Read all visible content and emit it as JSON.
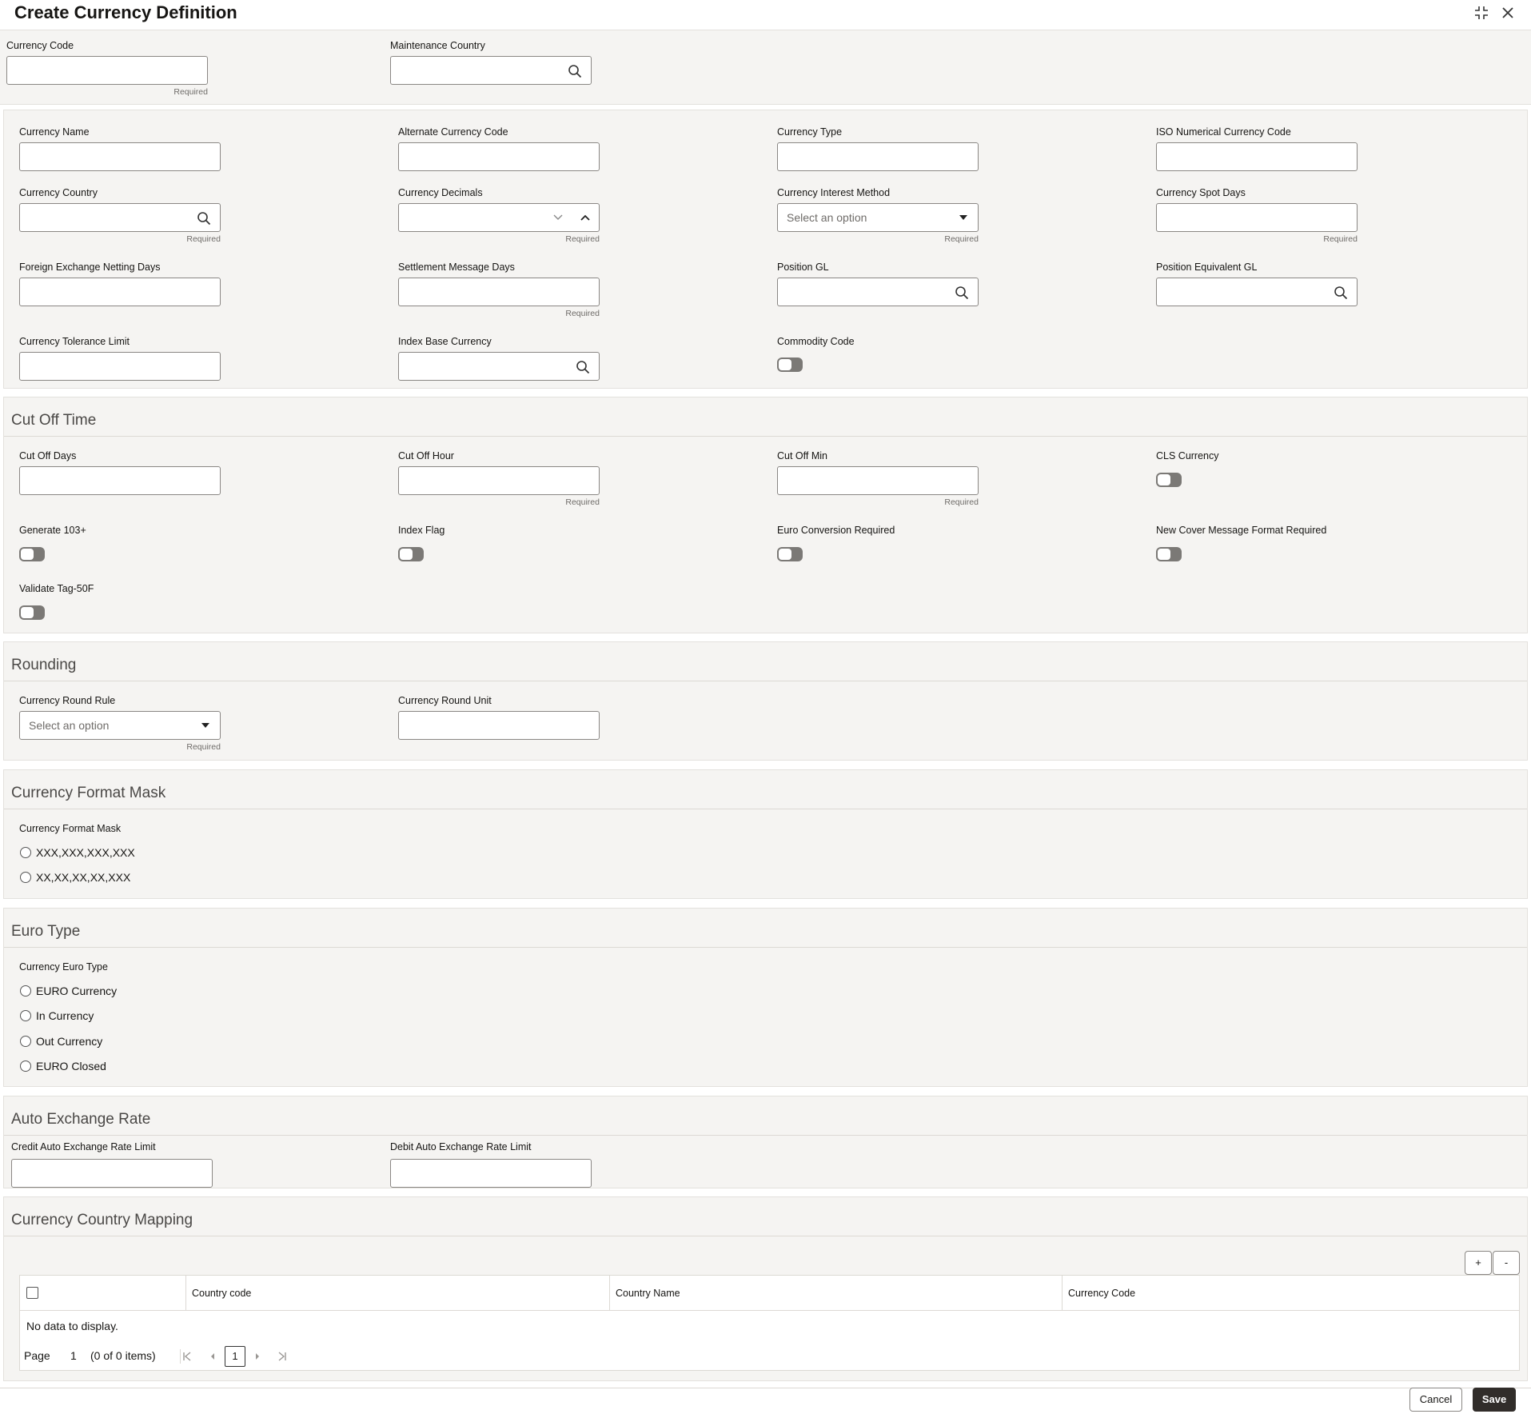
{
  "header": {
    "title": "Create Currency Definition"
  },
  "top": {
    "currency_code": {
      "label": "Currency Code",
      "value": "",
      "hint": "Required"
    },
    "maintenance_country": {
      "label": "Maintenance Country",
      "value": ""
    }
  },
  "main": {
    "currency_name": {
      "label": "Currency Name",
      "value": ""
    },
    "alternate_currency_code": {
      "label": "Alternate Currency Code",
      "value": ""
    },
    "currency_type": {
      "label": "Currency Type",
      "value": ""
    },
    "iso_numerical_code": {
      "label": "ISO Numerical Currency Code",
      "value": ""
    },
    "currency_country": {
      "label": "Currency Country",
      "value": "",
      "hint": "Required"
    },
    "currency_decimals": {
      "label": "Currency Decimals",
      "value": "",
      "hint": "Required"
    },
    "currency_interest_method": {
      "label": "Currency Interest Method",
      "placeholder": "Select an option",
      "hint": "Required"
    },
    "currency_spot_days": {
      "label": "Currency Spot Days",
      "value": "",
      "hint": "Required"
    },
    "fx_netting_days": {
      "label": "Foreign Exchange Netting Days",
      "value": ""
    },
    "settlement_message_days": {
      "label": "Settlement Message Days",
      "value": "",
      "hint": "Required"
    },
    "position_gl": {
      "label": "Position GL",
      "value": ""
    },
    "position_equivalent_gl": {
      "label": "Position Equivalent GL",
      "value": ""
    },
    "currency_tolerance_limit": {
      "label": "Currency Tolerance Limit",
      "value": ""
    },
    "index_base_currency": {
      "label": "Index Base Currency",
      "value": ""
    },
    "commodity_code": {
      "label": "Commodity Code",
      "on": false
    }
  },
  "cutoff": {
    "title": "Cut Off Time",
    "cut_off_days": {
      "label": "Cut Off Days",
      "value": ""
    },
    "cut_off_hour": {
      "label": "Cut Off Hour",
      "value": "",
      "hint": "Required"
    },
    "cut_off_min": {
      "label": "Cut Off Min",
      "value": "",
      "hint": "Required"
    },
    "cls_currency": {
      "label": "CLS Currency",
      "on": false
    },
    "generate_103": {
      "label": "Generate 103+",
      "on": false
    },
    "index_flag": {
      "label": "Index Flag",
      "on": false
    },
    "euro_conversion": {
      "label": "Euro Conversion Required",
      "on": false
    },
    "new_cover_message": {
      "label": "New Cover Message Format Required",
      "on": false
    },
    "validate_tag": {
      "label": "Validate Tag-50F",
      "on": false
    }
  },
  "rounding": {
    "title": "Rounding",
    "round_rule": {
      "label": "Currency Round Rule",
      "placeholder": "Select an option",
      "hint": "Required"
    },
    "round_unit": {
      "label": "Currency Round Unit",
      "value": ""
    }
  },
  "format_mask": {
    "title": "Currency Format Mask",
    "label": "Currency Format Mask",
    "options": [
      "XXX,XXX,XXX,XXX",
      "XX,XX,XX,XX,XXX"
    ]
  },
  "euro_type": {
    "title": "Euro Type",
    "label": "Currency Euro Type",
    "options": [
      "EURO Currency",
      "In Currency",
      "Out Currency",
      "EURO Closed"
    ]
  },
  "auto_exchange": {
    "title": "Auto Exchange Rate",
    "credit_limit": {
      "label": "Credit Auto Exchange Rate Limit",
      "value": ""
    },
    "debit_limit": {
      "label": "Debit Auto Exchange Rate Limit",
      "value": ""
    }
  },
  "mapping": {
    "title": "Currency Country Mapping",
    "add_label": "+",
    "remove_label": "-",
    "columns": [
      "Country code",
      "Country Name",
      "Currency Code"
    ],
    "empty_text": "No data to display.",
    "page_label": "Page",
    "page_number": "1",
    "items_text": "(0 of 0 items)",
    "current_page": "1"
  },
  "footer": {
    "cancel_label": "Cancel",
    "save_label": "Save"
  }
}
